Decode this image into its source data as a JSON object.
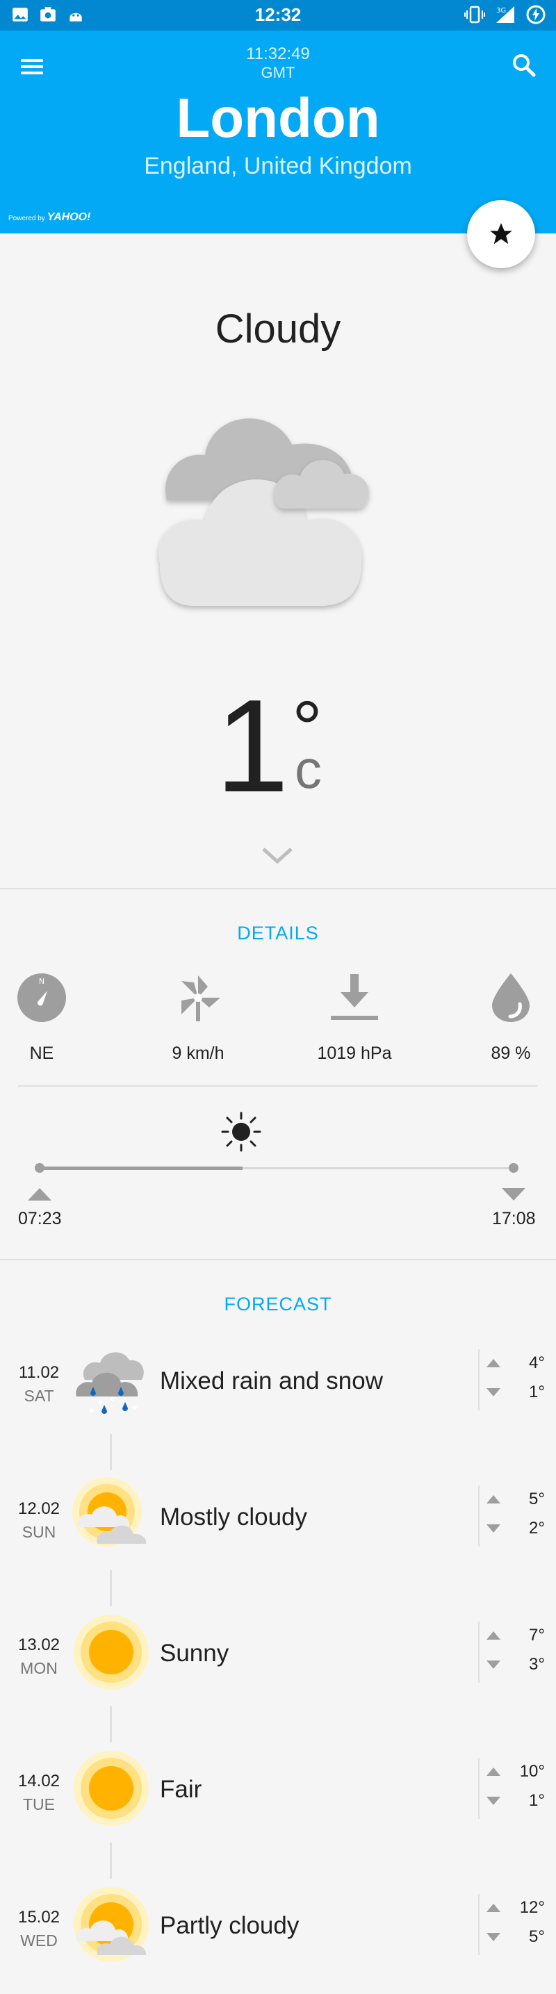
{
  "status_bar": {
    "time": "12:32"
  },
  "header": {
    "local_time": "11:32:49",
    "timezone": "GMT",
    "city": "London",
    "region": "England, United Kingdom",
    "powered_by_prefix": "Powered by",
    "powered_by_brand": "YAHOO!"
  },
  "current": {
    "condition": "Cloudy",
    "temperature": "1",
    "degree_symbol": "°",
    "unit": "c"
  },
  "details": {
    "title": "DETAILS",
    "wind_direction": "NE",
    "compass_label": "N",
    "wind_speed": "9 km/h",
    "pressure": "1019 hPa",
    "humidity": "89 %",
    "sunrise": "07:23",
    "sunset": "17:08",
    "daylight_progress": 0.43
  },
  "forecast": {
    "title": "FORECAST",
    "days": [
      {
        "date": "11.02",
        "weekday": "SAT",
        "condition": "Mixed rain and snow",
        "icon": "rain-snow-icon",
        "high": "4°",
        "low": "1°"
      },
      {
        "date": "12.02",
        "weekday": "SUN",
        "condition": "Mostly cloudy",
        "icon": "mostly-cloudy-icon",
        "high": "5°",
        "low": "2°"
      },
      {
        "date": "13.02",
        "weekday": "MON",
        "condition": "Sunny",
        "icon": "sunny-icon",
        "high": "7°",
        "low": "3°"
      },
      {
        "date": "14.02",
        "weekday": "TUE",
        "condition": "Fair",
        "icon": "sunny-icon",
        "high": "10°",
        "low": "1°"
      },
      {
        "date": "15.02",
        "weekday": "WED",
        "condition": "Partly cloudy",
        "icon": "partly-cloudy-icon",
        "high": "12°",
        "low": "5°"
      }
    ]
  },
  "colors": {
    "status_bar": "#0288d1",
    "header": "#03a9f4",
    "accent": "#03a9f4",
    "sun": "#ffb300"
  }
}
